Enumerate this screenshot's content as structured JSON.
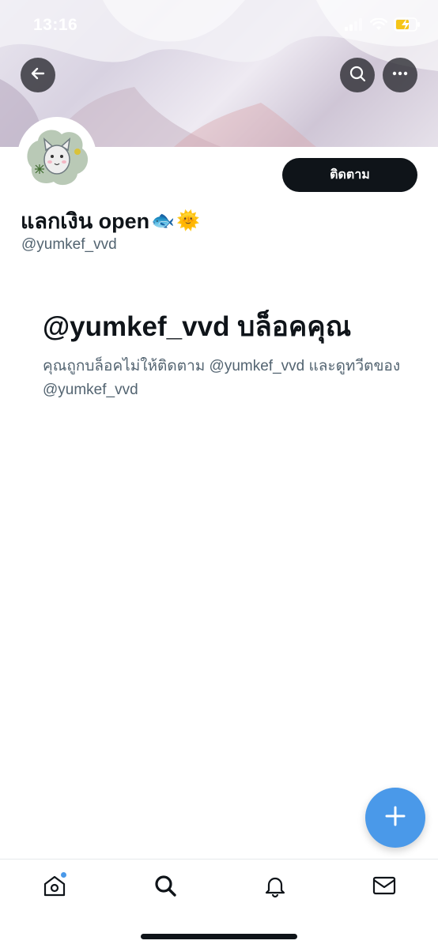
{
  "status_bar": {
    "time": "13:16",
    "signal_icon": "cellular-signal-icon",
    "wifi_icon": "wifi-icon",
    "battery_icon": "battery-charging-icon",
    "battery_color": "#f5c518"
  },
  "header": {
    "back_icon": "arrow-left-icon",
    "search_icon": "search-icon",
    "more_icon": "more-horizontal-icon"
  },
  "profile": {
    "display_name": "แลกเงิน open",
    "name_emojis": [
      "🐟",
      "🌞"
    ],
    "handle": "@yumkef_vvd",
    "follow_label": "ติดตาม"
  },
  "blocked": {
    "title": "@yumkef_vvd บล็อคคุณ",
    "description": "คุณถูกบล็อคไม่ให้ติดตาม @yumkef_vvd และดูทวีตของ @yumkef_vvd"
  },
  "fab": {
    "icon": "plus-icon"
  },
  "tabbar": {
    "items": [
      {
        "name": "home",
        "icon": "home-icon",
        "has_dot": true
      },
      {
        "name": "search",
        "icon": "search-icon"
      },
      {
        "name": "notifications",
        "icon": "bell-icon"
      },
      {
        "name": "messages",
        "icon": "mail-icon"
      }
    ]
  },
  "colors": {
    "accent": "#4a99e9",
    "text_primary": "#0f1419",
    "text_secondary": "#536471",
    "button_dark": "#0f1419"
  }
}
